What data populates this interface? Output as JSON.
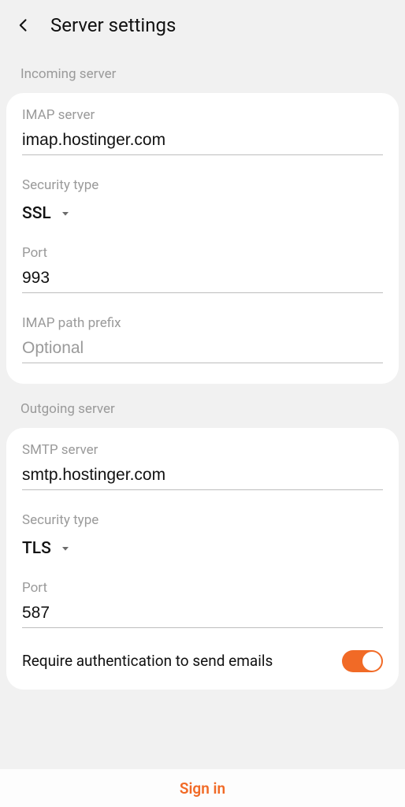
{
  "header": {
    "title": "Server settings"
  },
  "sections": {
    "incoming_title": "Incoming server",
    "outgoing_title": "Outgoing server"
  },
  "incoming": {
    "imap_server_label": "IMAP server",
    "imap_server_value": "imap.hostinger.com",
    "security_label": "Security type",
    "security_value": "SSL",
    "port_label": "Port",
    "port_value": "993",
    "prefix_label": "IMAP path prefix",
    "prefix_placeholder": "Optional"
  },
  "outgoing": {
    "smtp_server_label": "SMTP server",
    "smtp_server_value": "smtp.hostinger.com",
    "security_label": "Security type",
    "security_value": "TLS",
    "port_label": "Port",
    "port_value": "587",
    "auth_label": "Require authentication to send emails",
    "auth_on": true
  },
  "footer": {
    "signin": "Sign in"
  },
  "colors": {
    "accent": "#f16a26"
  }
}
